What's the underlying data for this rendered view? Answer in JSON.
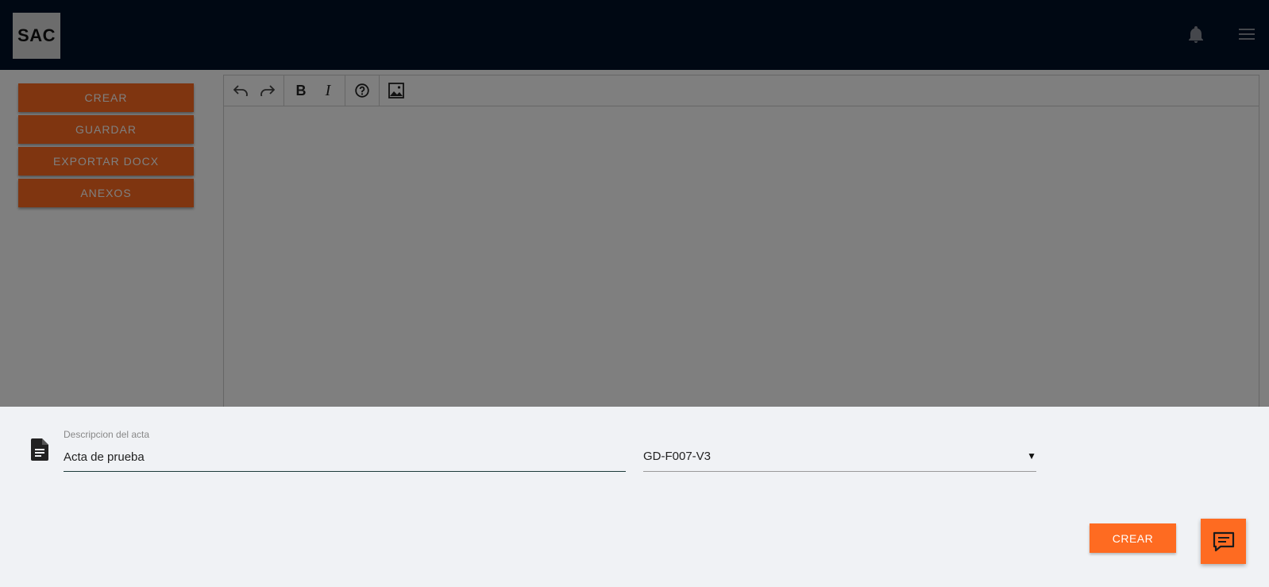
{
  "app": {
    "logo_text": "SAC",
    "colors": {
      "topbar": "#011126",
      "accent": "#fe6b21",
      "sheet_background": "#f0f2f5"
    }
  },
  "header": {
    "icons": [
      "bell-icon",
      "hamburger-menu-icon"
    ]
  },
  "sidebar": {
    "buttons": [
      {
        "label": "CREAR"
      },
      {
        "label": "GUARDAR"
      },
      {
        "label": "EXPORTAR DOCX"
      },
      {
        "label": "ANEXOS"
      }
    ]
  },
  "editor": {
    "toolbar_icons": [
      "undo-icon",
      "redo-icon",
      "bold-icon",
      "italic-icon",
      "help-icon",
      "image-icon"
    ]
  },
  "dialog": {
    "description_label": "Descripcion del acta",
    "description_value": "Acta de prueba",
    "template_selected": "GD-F007-V3",
    "create_label": "CREAR",
    "chat_icon": "chat-icon"
  }
}
